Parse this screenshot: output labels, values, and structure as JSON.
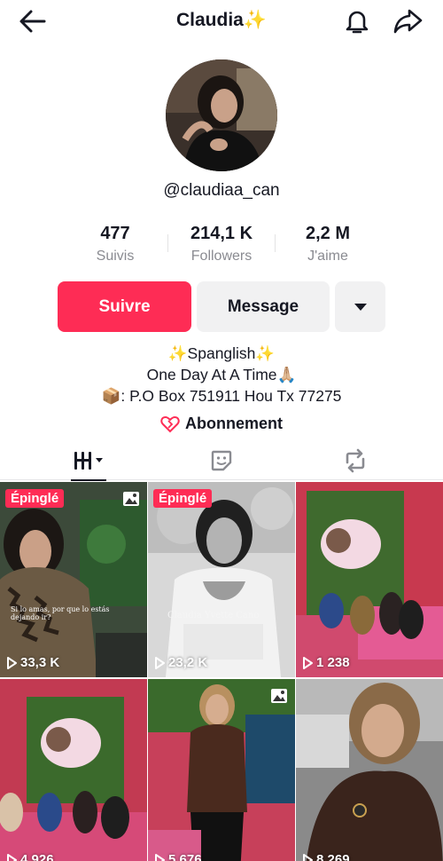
{
  "header": {
    "title": "Claudia✨",
    "back_icon": "arrow-left-icon",
    "bell_icon": "bell-icon",
    "share_icon": "share-arrow-icon"
  },
  "profile": {
    "username": "@claudiaa_can",
    "avatar_icon": "avatar"
  },
  "stats": [
    {
      "value": "477",
      "label": "Suivis"
    },
    {
      "value": "214,1 K",
      "label": "Followers"
    },
    {
      "value": "2,2 M",
      "label": "J'aime"
    }
  ],
  "actions": {
    "follow_label": "Suivre",
    "message_label": "Message",
    "follow_color": "#fe2c55"
  },
  "bio": {
    "line1": "✨Spanglish✨",
    "line2": "One Day At A Time🙏🏼",
    "line3": "📦: P.O Box 751911 Hou Tx 77275"
  },
  "subscription": {
    "label": "Abonnement"
  },
  "tabs": [
    {
      "icon": "grid-icon"
    },
    {
      "icon": "tagged-icon"
    },
    {
      "icon": "repost-icon"
    }
  ],
  "videos": [
    {
      "views": "33,3 K",
      "pinned": "Épinglé",
      "photo": true,
      "caption": "Si lo amas, por que lo estás dejando ir?"
    },
    {
      "views": "23,2 K",
      "pinned": "Épinglé",
      "photo": false,
      "caption": "Claudia Yvette Cano"
    },
    {
      "views": "1 238",
      "pinned": "",
      "photo": false,
      "caption": ""
    },
    {
      "views": "4 926",
      "pinned": "",
      "photo": false,
      "caption": ""
    },
    {
      "views": "5 676",
      "pinned": "",
      "photo": true,
      "caption": ""
    },
    {
      "views": "8 269",
      "pinned": "",
      "photo": false,
      "caption": ""
    }
  ]
}
